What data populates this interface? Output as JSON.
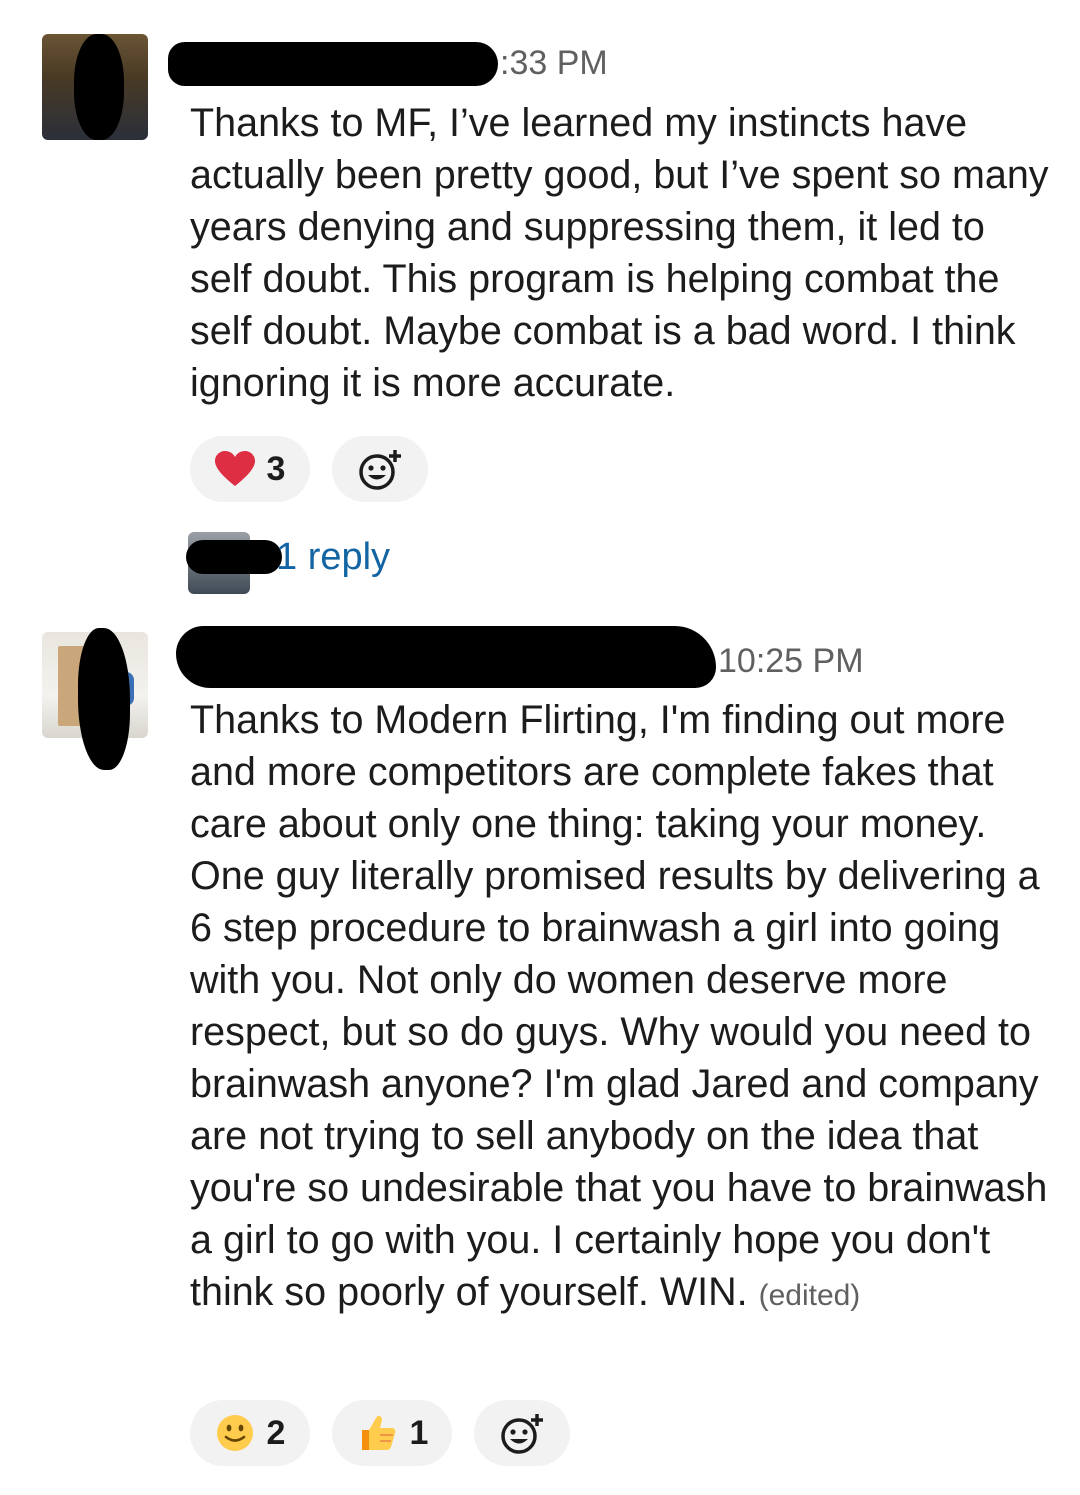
{
  "messages": [
    {
      "time": ":33 PM",
      "text": "Thanks to MF, I’ve learned my instincts have actually been pretty good, but I’ve spent so many years denying and suppressing them, it led to self doubt. This program is helping combat the self doubt. Maybe combat is a bad word. I think ignoring it is more accurate.",
      "reactions": [
        {
          "emoji": "heart-icon",
          "glyph": "❤",
          "count": "3",
          "color": "#dd2e44"
        }
      ],
      "reply_text": "1 reply"
    },
    {
      "time": "10:25 PM",
      "text": "Thanks to Modern Flirting,  I'm finding out more and more competitors are complete fakes that care about only one thing: taking your money. One guy literally promised results by delivering a 6 step procedure to brainwash a girl into going with you. Not only do women deserve more respect, but so do guys. Why would you need to brainwash anyone? I'm glad Jared and company are not trying to sell anybody on the idea that you're so undesirable that you have to brainwash a girl to go with you. I certainly hope you don't think so poorly of yourself. WIN.",
      "edited": "(edited)",
      "reactions": [
        {
          "emoji": "slightly-smiling-face-icon",
          "glyph": "🙂",
          "count": "2"
        },
        {
          "emoji": "thumbs-up-icon",
          "glyph": "👍",
          "count": "1"
        }
      ]
    }
  ],
  "colors": {
    "text": "#1d1c1d",
    "timestamp": "#616061",
    "link": "#1264a3",
    "reaction_bg": "#f2f2f2"
  }
}
